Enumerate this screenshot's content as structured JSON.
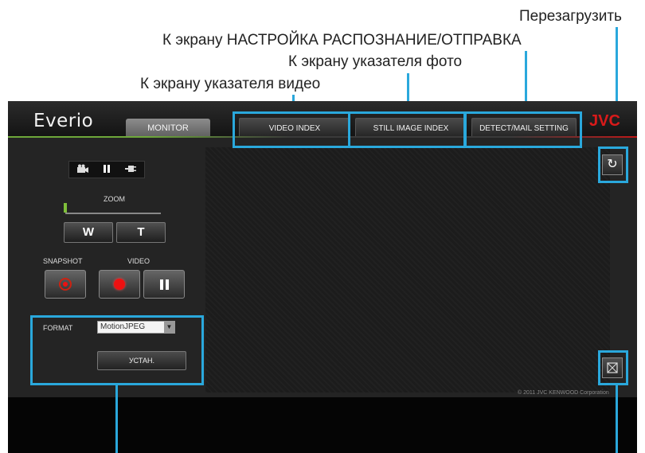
{
  "callouts": {
    "reload": "Перезагрузить",
    "detect_mail": "К экрану НАСТРОЙКА РАСПОЗНАНИЕ/ОТПРАВКА",
    "still_index": "К экрану указателя фото",
    "video_index": "К экрану указателя видео"
  },
  "app": {
    "logo": "Everio",
    "brand": "JVC",
    "tabs": {
      "monitor": "MONITOR",
      "video_index": "VIDEO INDEX",
      "still_image_index": "STILL IMAGE INDEX",
      "detect_mail_setting": "DETECT/MAIL SETTING"
    },
    "controls": {
      "zoom_label": "ZOOM",
      "zoom_wide": "W",
      "zoom_tele": "T",
      "snapshot_label": "SNAPSHOT",
      "video_label": "VIDEO",
      "format_label": "FORMAT",
      "format_value": "MotionJPEG",
      "set_button": "УСТАН."
    },
    "copyright": "© 2011 JVC KENWOOD Corporation"
  },
  "colors": {
    "highlight": "#2aa8dc",
    "brand": "#d91a1a",
    "record": "#e11111"
  }
}
